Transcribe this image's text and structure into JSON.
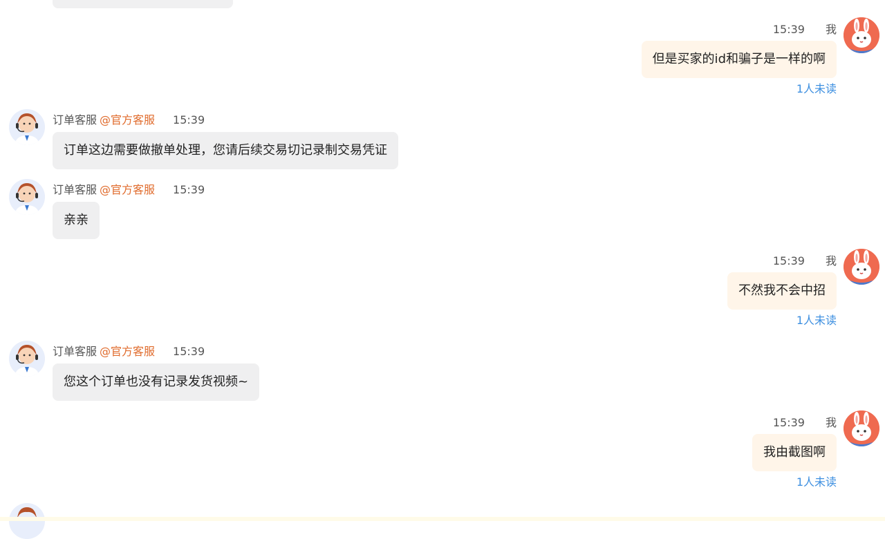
{
  "messages": [
    {
      "dir": "out",
      "time": "15:39",
      "sender": "我",
      "text": "但是买家的id和骗子是一样的啊",
      "read_status": "1人未读"
    },
    {
      "dir": "in",
      "sender": "订单客服",
      "tag": "@官方客服",
      "time": "15:39",
      "text": "订单这边需要做撤单处理，您请后续交易切记录制交易凭证"
    },
    {
      "dir": "in",
      "sender": "订单客服",
      "tag": "@官方客服",
      "time": "15:39",
      "text": "亲亲"
    },
    {
      "dir": "out",
      "time": "15:39",
      "sender": "我",
      "text": "不然我不会中招",
      "read_status": "1人未读"
    },
    {
      "dir": "in",
      "sender": "订单客服",
      "tag": "@官方客服",
      "time": "15:39",
      "text": "您这个订单也没有记录发货视频~"
    },
    {
      "dir": "out",
      "time": "15:39",
      "sender": "我",
      "text": "我由截图啊",
      "read_status": "1人未读"
    }
  ],
  "colors": {
    "incoming_bubble": "#efeff0",
    "outgoing_bubble": "#fff5e9",
    "official_tag": "#e06b2c",
    "read_status": "#3d8fe0"
  },
  "icons": {
    "agent_avatar": "customer-service-agent-avatar",
    "user_avatar": "rabbit-avatar"
  }
}
